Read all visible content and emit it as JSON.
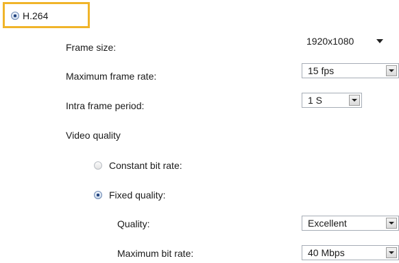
{
  "codec": {
    "label": "H.264",
    "selected": true
  },
  "settings": {
    "frame_size": {
      "label": "Frame size:",
      "value": "1920x1080"
    },
    "max_frame_rate": {
      "label": "Maximum frame rate:",
      "value": "15 fps"
    },
    "intra_frame_period": {
      "label": "Intra frame period:",
      "value": "1 S"
    },
    "video_quality": {
      "label": "Video quality",
      "constant_bit_rate": {
        "label": "Constant bit rate:",
        "selected": false
      },
      "fixed_quality": {
        "label": "Fixed quality:",
        "selected": true
      },
      "quality": {
        "label": "Quality:",
        "value": "Excellent"
      },
      "max_bit_rate": {
        "label": "Maximum bit rate:",
        "value": "40 Mbps"
      }
    }
  },
  "colors": {
    "highlight": "#f0b429"
  }
}
